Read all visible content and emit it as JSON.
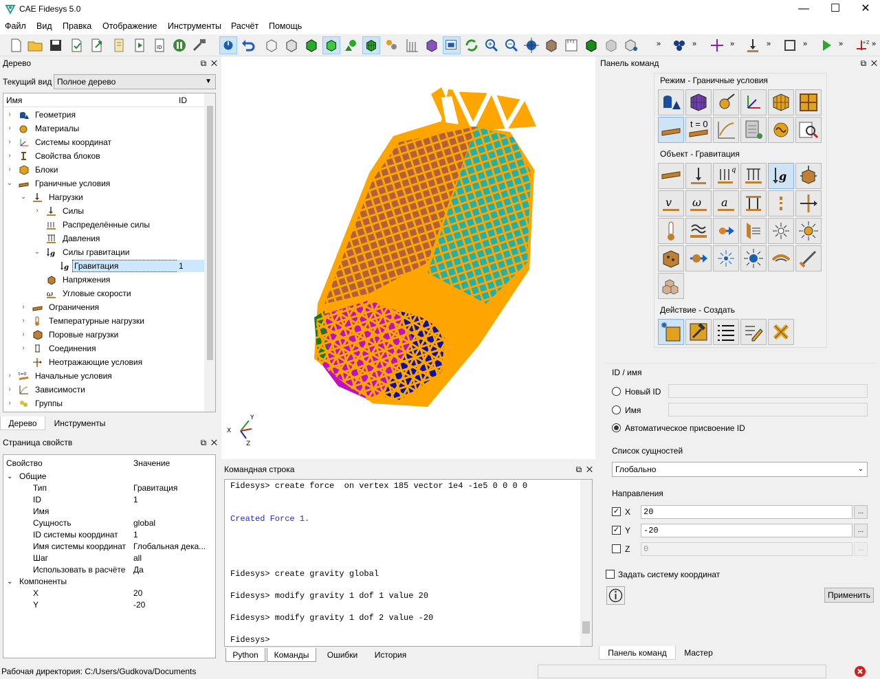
{
  "window": {
    "title": "CAE Fidesys 5.0",
    "minimize": "—",
    "maximize": "☐",
    "close": "✕"
  },
  "menu": [
    "Файл",
    "Вид",
    "Правка",
    "Отображение",
    "Инструменты",
    "Расчёт",
    "Помощь"
  ],
  "tree_panel": {
    "title": "Дерево",
    "view_label": "Текущий вид",
    "view_value": "Полное дерево",
    "col_name": "Имя",
    "col_id": "ID",
    "items": [
      {
        "label": "Геометрия",
        "id": ""
      },
      {
        "label": "Материалы",
        "id": ""
      },
      {
        "label": "Системы координат",
        "id": ""
      },
      {
        "label": "Свойства блоков",
        "id": ""
      },
      {
        "label": "Блоки",
        "id": ""
      },
      {
        "label": "Граничные условия",
        "id": ""
      },
      {
        "label": "Нагрузки",
        "id": ""
      },
      {
        "label": "Силы",
        "id": ""
      },
      {
        "label": "Распределённые силы",
        "id": ""
      },
      {
        "label": "Давления",
        "id": ""
      },
      {
        "label": "Силы гравитации",
        "id": ""
      },
      {
        "label": "Гравитация",
        "id": "1"
      },
      {
        "label": "Напряжения",
        "id": ""
      },
      {
        "label": "Угловые скорости",
        "id": ""
      },
      {
        "label": "Ограничения",
        "id": ""
      },
      {
        "label": "Температурные нагрузки",
        "id": ""
      },
      {
        "label": "Поровые нагрузки",
        "id": ""
      },
      {
        "label": "Соединения",
        "id": ""
      },
      {
        "label": "Неотражающие условия",
        "id": ""
      },
      {
        "label": "Начальные условия",
        "id": ""
      },
      {
        "label": "Зависимости",
        "id": ""
      },
      {
        "label": "Группы",
        "id": ""
      }
    ],
    "tabs": [
      "Дерево",
      "Инструменты"
    ]
  },
  "props_panel": {
    "title": "Страница свойств",
    "col_prop": "Свойство",
    "col_value": "Значение",
    "group_general": "Общие",
    "rows": [
      {
        "name": "Тип",
        "value": "Гравитация"
      },
      {
        "name": "ID",
        "value": "1"
      },
      {
        "name": "Имя",
        "value": ""
      },
      {
        "name": "Сущность",
        "value": "global"
      },
      {
        "name": "ID системы координат",
        "value": "1"
      },
      {
        "name": "Имя системы координат",
        "value": "Глобальная дека..."
      },
      {
        "name": "Шаг",
        "value": "all"
      },
      {
        "name": "Использовать в расчёте",
        "value": "Да"
      }
    ],
    "group_components": "Компоненты",
    "components": [
      {
        "name": "X",
        "value": "20"
      },
      {
        "name": "Y",
        "value": "-20"
      }
    ]
  },
  "cmd_panel": {
    "title": "Командная строка",
    "lines": [
      {
        "text": "Fidesys> create force  on vertex 185 vector 1e4 -1e5 0 0 0 0",
        "color": "#000000"
      },
      {
        "text": "Created Force 1.",
        "color": "#2a2ad0"
      },
      {
        "text": "Fidesys> create gravity global",
        "color": "#000000"
      },
      {
        "text": "Fidesys> modify gravity 1 dof 1 value 20",
        "color": "#000000"
      },
      {
        "text": "Fidesys> modify gravity 1 dof 2 value -20",
        "color": "#000000"
      },
      {
        "text": "Fidesys>",
        "color": "#000000"
      }
    ],
    "tabs": [
      "Python",
      "Команды",
      "Ошибки",
      "История"
    ]
  },
  "axes": {
    "x": "X",
    "y": "Y",
    "z": "Z"
  },
  "command_panel": {
    "title": "Панель команд",
    "mode_title": "Режим - Граничные условия",
    "object_title": "Объект - Гравитация",
    "action_title": "Действие - Создать",
    "t0_label": "t = 0",
    "idname_title": "ID / имя",
    "new_id_label": "Новый ID",
    "name_label": "Имя",
    "auto_id_label": "Автоматическое присвоение ID",
    "entities_title": "Список сущностей",
    "entities_value": "Глобально",
    "directions_title": "Направления",
    "dir_x_label": "X",
    "dir_x_value": "20",
    "dir_y_label": "Y",
    "dir_y_value": "-20",
    "dir_z_label": "Z",
    "dir_z_value": "0",
    "browse": "...",
    "coord_label": "Задать систему координат",
    "apply_label": "Применить",
    "tabs": [
      "Панель команд",
      "Мастер"
    ]
  },
  "status": {
    "workdir": "Рабочая директория: C:/Users/Gudkova/Documents"
  },
  "colors": {
    "mesh_orange": "#ffa500",
    "cyan": "#20b2aa",
    "brown": "#b0603a",
    "magenta": "#c010c0",
    "blue": "#1010a0",
    "green": "#1a7a1a",
    "selection": "#cce8ff"
  }
}
